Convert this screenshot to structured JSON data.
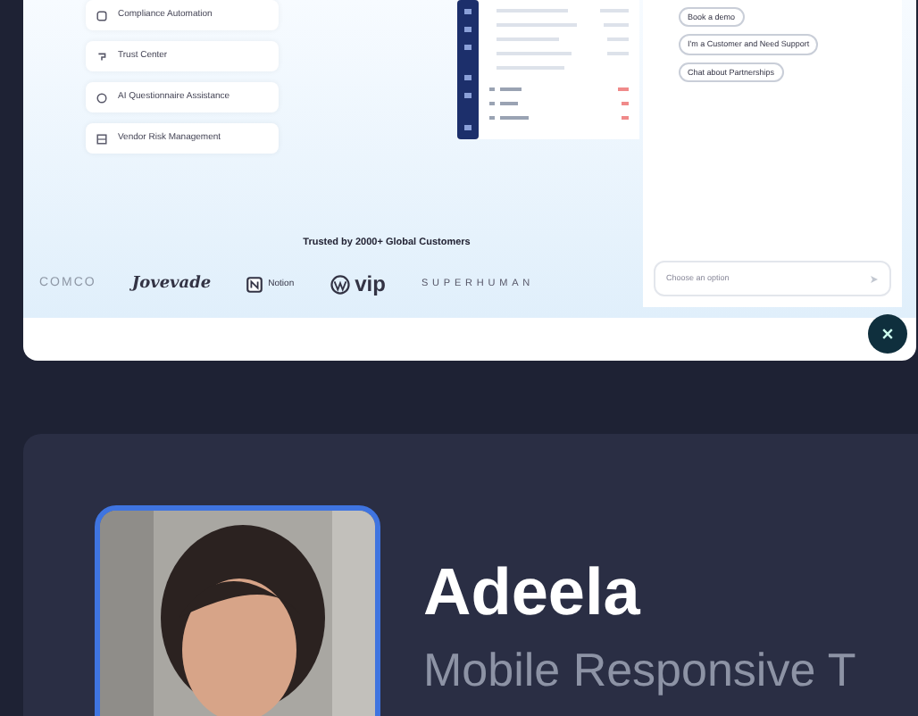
{
  "features": [
    {
      "label": "Compliance Automation"
    },
    {
      "label": "Trust Center"
    },
    {
      "label": "AI Questionnaire Assistance"
    },
    {
      "label": "Vendor Risk Management"
    }
  ],
  "trusted": {
    "heading": "Trusted by 2000+ Global Customers",
    "logos": [
      {
        "kind": "faded",
        "text": "COMCO"
      },
      {
        "kind": "script",
        "text": "Jovevade"
      },
      {
        "kind": "boxed",
        "text": "Notion"
      },
      {
        "kind": "circle",
        "text": "vip"
      },
      {
        "kind": "spaced",
        "text": "SUPERHUMAN"
      }
    ]
  },
  "chat": {
    "options": [
      "Book a demo",
      "I'm a Customer and Need Support",
      "Chat about Partnerships"
    ],
    "placeholder": "Choose an option"
  },
  "profile": {
    "name": "Adeela",
    "subtitle": "Mobile Responsive T"
  }
}
